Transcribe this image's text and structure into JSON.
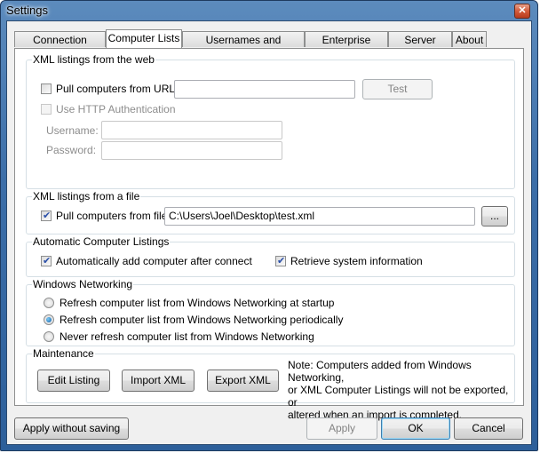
{
  "window": {
    "title": "Settings",
    "close_icon": "close-icon"
  },
  "tabs": [
    {
      "label": "Connection Options",
      "active": false
    },
    {
      "label": "Computer Lists",
      "active": true
    },
    {
      "label": "Usernames and Passwords",
      "active": false
    },
    {
      "label": "Enterprise Server",
      "active": false
    },
    {
      "label": "Server Install",
      "active": false
    },
    {
      "label": "About",
      "active": false
    }
  ],
  "web_group": {
    "title": "XML listings from the web",
    "pull_url_label": "Pull computers from URL:",
    "pull_url_checked": false,
    "url_value": "",
    "test_label": "Test",
    "http_auth_label": "Use HTTP Authentication",
    "http_auth_checked": false,
    "username_label": "Username:",
    "username_value": "",
    "password_label": "Password:",
    "password_value": ""
  },
  "file_group": {
    "title": "XML listings from a file",
    "pull_file_label": "Pull computers from file:",
    "pull_file_checked": true,
    "file_path": "C:\\Users\\Joel\\Desktop\\test.xml",
    "browse_label": "..."
  },
  "auto_group": {
    "title": "Automatic Computer Listings",
    "auto_add_label": "Automatically add computer after connect",
    "auto_add_checked": true,
    "retrieve_info_label": "Retrieve system information",
    "retrieve_info_checked": true
  },
  "networking_group": {
    "title": "Windows Networking",
    "options": [
      {
        "label": "Refresh computer list from Windows Networking at startup",
        "selected": false
      },
      {
        "label": "Refresh computer list from Windows Networking periodically",
        "selected": true
      },
      {
        "label": "Never refresh computer list from Windows Networking",
        "selected": false
      }
    ]
  },
  "maintenance_group": {
    "title": "Maintenance",
    "edit_label": "Edit Listing",
    "import_label": "Import XML",
    "export_label": "Export XML",
    "note_lines": [
      "Note: Computers added from Windows Networking,",
      "or XML Computer Listings will not be exported, or",
      "altered when an import is completed."
    ]
  },
  "footer": {
    "apply_without_saving_label": "Apply without saving",
    "apply_label": "Apply",
    "ok_label": "OK",
    "cancel_label": "Cancel"
  }
}
